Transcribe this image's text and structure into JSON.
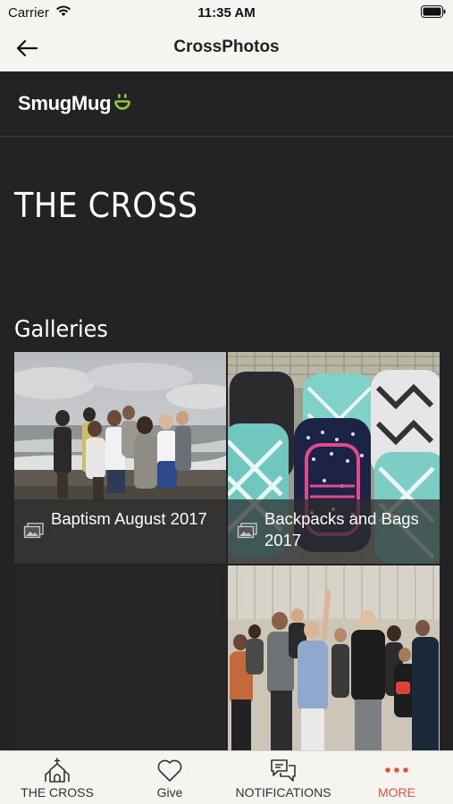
{
  "status_bar": {
    "carrier": "Carrier",
    "time": "11:35 AM"
  },
  "nav": {
    "title": "CrossPhotos"
  },
  "site": {
    "logo": "SmugMug",
    "title": "THE CROSS",
    "galleries_heading": "Galleries",
    "galleries": [
      {
        "title": "Baptism August 2017"
      },
      {
        "title": "Backpacks and Bags 2017"
      },
      {
        "title": ""
      },
      {
        "title": ""
      }
    ]
  },
  "tabs": [
    {
      "label": "THE CROSS",
      "icon": "church-icon"
    },
    {
      "label": "Give",
      "icon": "heart-icon"
    },
    {
      "label": "NOTIFICATIONS",
      "icon": "chat-bubbles-icon"
    },
    {
      "label": "MORE",
      "icon": "more-dots-icon",
      "active": true
    }
  ],
  "colors": {
    "accent": "#e0553b",
    "smugmug_green": "#8dc63f",
    "content_bg": "#232325"
  }
}
